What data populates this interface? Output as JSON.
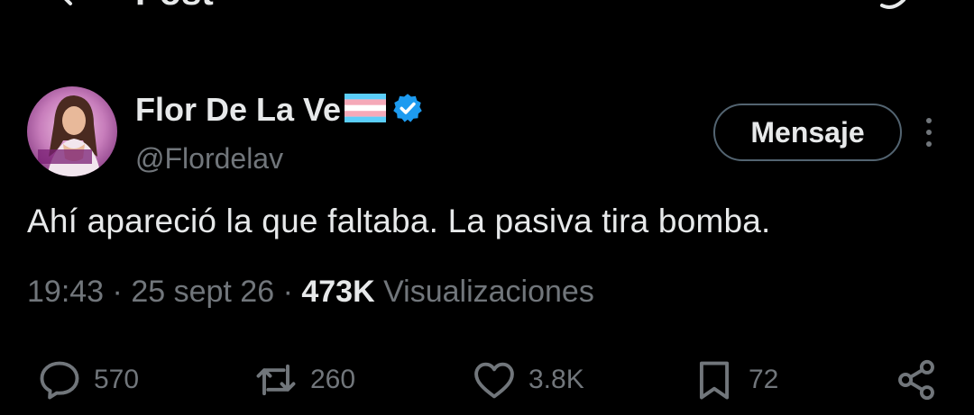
{
  "header": {
    "title": "Post"
  },
  "author": {
    "name": "Flor De La Ve",
    "handle": "@Flordelav",
    "avatar_text": "FLOR DE LA VE"
  },
  "actions": {
    "message_label": "Mensaje"
  },
  "tweet": {
    "text": "Ahí apareció la que faltaba. La pasiva tira bomba.",
    "time": "19:43",
    "date": "25 sept 26",
    "views_count": "473K",
    "views_label": "Visualizaciones",
    "separator": "·"
  },
  "engagement": {
    "replies": "570",
    "reposts": "260",
    "likes": "3.8K",
    "bookmarks": "72"
  },
  "icons": {
    "back": "arrow-left-icon",
    "grok": "grok-icon",
    "flag": "transgender-flag-icon",
    "verified": "verified-badge-icon",
    "more": "more-vertical-icon",
    "reply": "reply-icon",
    "repost": "repost-icon",
    "like": "heart-icon",
    "bookmark": "bookmark-icon",
    "share": "share-icon"
  },
  "colors": {
    "background": "#000000",
    "text": "#e7e9ea",
    "secondary_text": "#71767b",
    "verified": "#1d9bf0",
    "button_border": "#536471",
    "flag_blue": "#5bcefa",
    "flag_pink": "#f5a9b8",
    "flag_white": "#ffffff"
  }
}
